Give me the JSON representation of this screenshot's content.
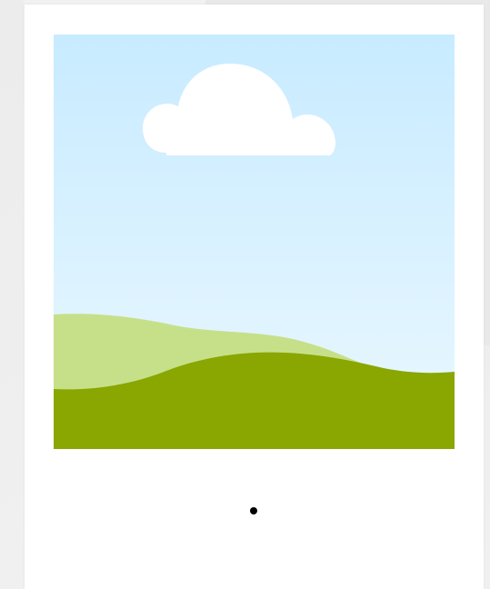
{
  "colors": {
    "page_background": "#eeeeee",
    "card_background": "#ffffff",
    "sky_top": "#c8ebff",
    "sky_bottom": "#eaf8ff",
    "hill_light": "#c6e08a",
    "hill_dark": "#8aa600",
    "cloud": "#ffffff",
    "dot": "#000000"
  },
  "illustration": {
    "type": "landscape-placeholder",
    "icons": [
      "cloud-icon",
      "hill-icon"
    ]
  },
  "carousel": {
    "page_count": 1,
    "active_page": 1
  }
}
